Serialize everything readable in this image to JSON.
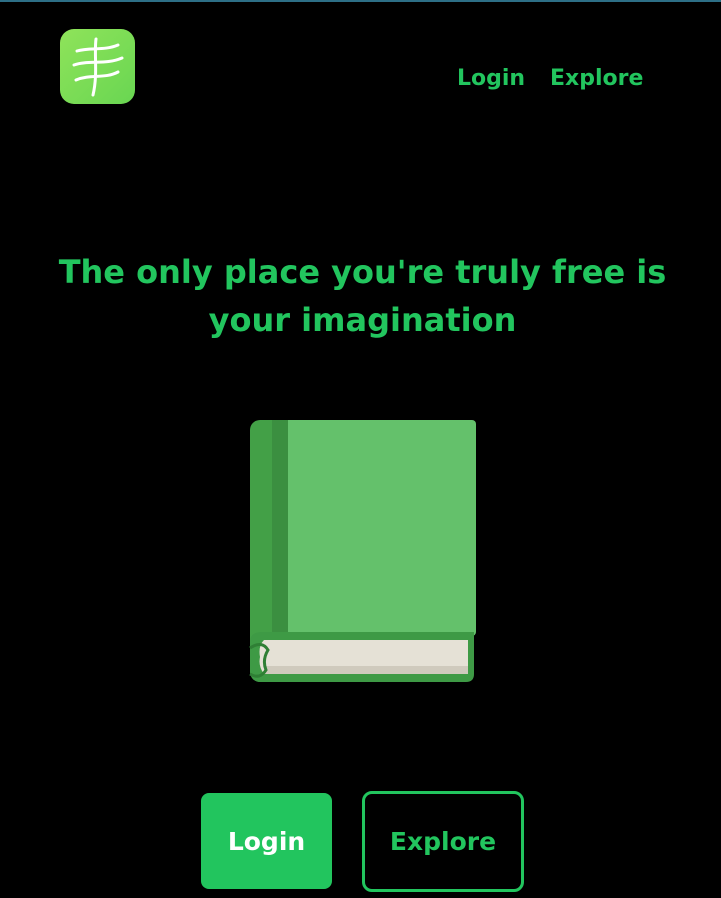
{
  "theme": {
    "accent": "#22c55e",
    "background": "#000000",
    "logo_color": "#7ddd55",
    "book_cover": "#64c16b",
    "book_spine": "#43a047"
  },
  "header": {
    "logo_icon": "feather-lines-icon",
    "nav": {
      "login_label": "Login",
      "explore_label": "Explore"
    }
  },
  "hero": {
    "headline": "The only place you're truly free is your imagination",
    "illustration": "green-book-icon"
  },
  "actions": {
    "login_label": "Login",
    "explore_label": "Explore"
  }
}
